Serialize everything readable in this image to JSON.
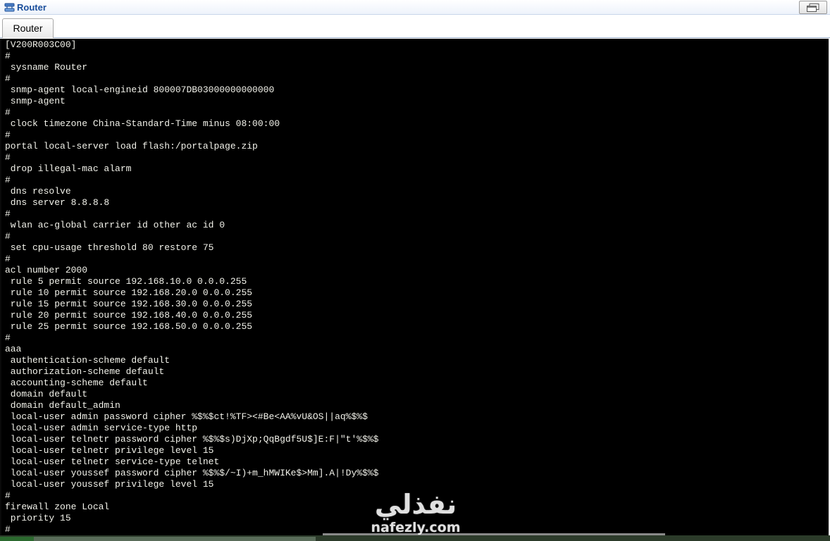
{
  "window": {
    "title": "Router",
    "app_icon": "router-device-icon",
    "restore_icon": "restore-window-icon"
  },
  "tabs": [
    {
      "label": "Router",
      "active": true
    }
  ],
  "console": {
    "lines": [
      "[V200R003C00]",
      "#",
      " sysname Router",
      "#",
      " snmp-agent local-engineid 800007DB03000000000000",
      " snmp-agent",
      "#",
      " clock timezone China-Standard-Time minus 08:00:00",
      "#",
      "portal local-server load flash:/portalpage.zip",
      "#",
      " drop illegal-mac alarm",
      "#",
      " dns resolve",
      " dns server 8.8.8.8",
      "#",
      " wlan ac-global carrier id other ac id 0",
      "#",
      " set cpu-usage threshold 80 restore 75",
      "#",
      "acl number 2000",
      " rule 5 permit source 192.168.10.0 0.0.0.255",
      " rule 10 permit source 192.168.20.0 0.0.0.255",
      " rule 15 permit source 192.168.30.0 0.0.0.255",
      " rule 20 permit source 192.168.40.0 0.0.0.255",
      " rule 25 permit source 192.168.50.0 0.0.0.255",
      "#",
      "aaa",
      " authentication-scheme default",
      " authorization-scheme default",
      " accounting-scheme default",
      " domain default",
      " domain default_admin",
      " local-user admin password cipher %$%$ct!%TF><#Be<AA%vU&OS||aq%$%$",
      " local-user admin service-type http",
      " local-user telnetr password cipher %$%$s)DjXp;QqBgdf5U$]E:F|\"t'%$%$",
      " local-user telnetr privilege level 15",
      " local-user telnetr service-type telnet",
      " local-user youssef password cipher %$%$/~I)+m_hMWIKe$>Mm].A|!Dy%$%$",
      " local-user youssef privilege level 15",
      "#",
      "firewall zone Local",
      " priority 15",
      "#"
    ]
  },
  "watermark": {
    "arabic": "نفذلي",
    "latin": "nafezly.com"
  },
  "colors": {
    "console_bg": "#000000",
    "console_text": "#f2f2ea",
    "title_text": "#1a4e9b"
  }
}
